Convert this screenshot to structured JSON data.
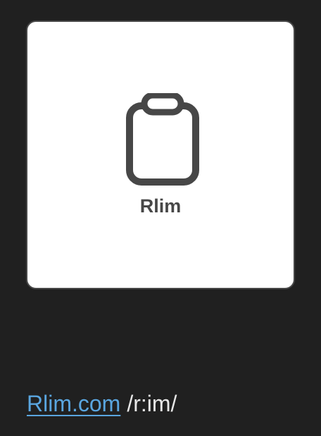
{
  "card": {
    "icon": "clipboard-icon",
    "label": "Rlim"
  },
  "footer": {
    "link_text": "Rlim.com",
    "pronunciation": "/r:im/"
  },
  "colors": {
    "background": "#202020",
    "card": "#ffffff",
    "icon": "#474747",
    "link": "#5aa6e0",
    "text": "#e8e8e8"
  }
}
